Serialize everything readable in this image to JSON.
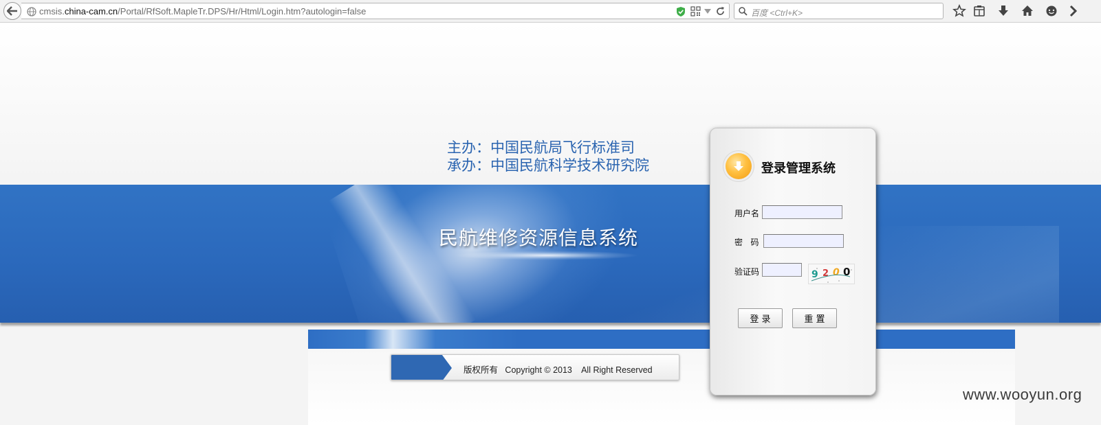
{
  "browser": {
    "url_prefix": "cmsis.",
    "url_domain": "china-cam.cn",
    "url_path": "/Portal/RfSoft.MapleTr.DPS/Hr/Html/Login.htm?autologin=false",
    "search_placeholder": "百度 <Ctrl+K>"
  },
  "header": {
    "organizer": "主办：中国民航局飞行标准司",
    "undertaker": "承办：中国民航科学技术研究院"
  },
  "banner": {
    "system_title": "民航维修资源信息系统"
  },
  "footer": {
    "copyright": "版权所有   Copyright © 2013    All Right Reserved"
  },
  "login": {
    "heading": "登录管理系统",
    "username_label": "用户名",
    "password_label": "密   码",
    "captcha_label": "验证码",
    "captcha_digits": [
      "9",
      "2",
      "0",
      "0"
    ],
    "login_button": "登 录",
    "reset_button": "重 置"
  },
  "watermark": "www.wooyun.org",
  "colors": {
    "band_blue": "#2b69bc",
    "org_text": "#2a64b0",
    "login_icon": "#f5a623"
  },
  "icons": [
    "back-arrow-icon",
    "globe-icon",
    "shield-icon",
    "qr-code-icon",
    "dropdown-icon",
    "reload-icon",
    "search-icon",
    "star-icon",
    "reading-list-icon",
    "download-icon",
    "home-icon",
    "chat-icon",
    "download-arrow-icon"
  ]
}
